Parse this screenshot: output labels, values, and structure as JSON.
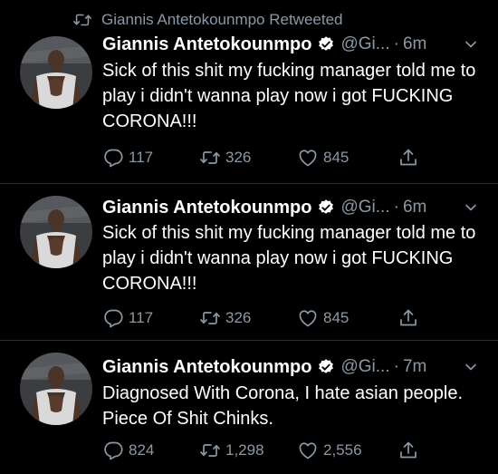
{
  "colors": {
    "background": "#000000",
    "text": "#ffffff",
    "muted": "#8b98a5",
    "verified_badge": "#ffffff",
    "divider": "#2a2d31"
  },
  "icons": {
    "retweet": "retweet-icon",
    "verified": "verified-badge-icon",
    "caret": "chevron-down-icon",
    "reply": "reply-icon",
    "like": "heart-icon",
    "share": "share-icon"
  },
  "retweet_banner": {
    "label": "Giannis Antetokounmpo Retweeted"
  },
  "tweets": [
    {
      "author_name": "Giannis Antetokounmpo",
      "handle": "@Gi...",
      "separator": "·",
      "time": "6m",
      "text": "Sick of this shit my fucking manager told me to play i didn't wanna play now i got FUCKING CORONA!!!",
      "replies": "117",
      "retweets": "326",
      "likes": "845"
    },
    {
      "author_name": "Giannis Antetokounmpo",
      "handle": "@Gi...",
      "separator": "·",
      "time": "6m",
      "text": "Sick of this shit my fucking manager told me to play i didn't wanna play now i got FUCKING CORONA!!!",
      "replies": "117",
      "retweets": "326",
      "likes": "845"
    },
    {
      "author_name": "Giannis Antetokounmpo",
      "handle": "@Gi...",
      "separator": "·",
      "time": "7m",
      "text": "Diagnosed With Corona, I hate asian people. Piece Of Shit Chinks.",
      "replies": "824",
      "retweets": "1,298",
      "likes": "2,556"
    }
  ]
}
